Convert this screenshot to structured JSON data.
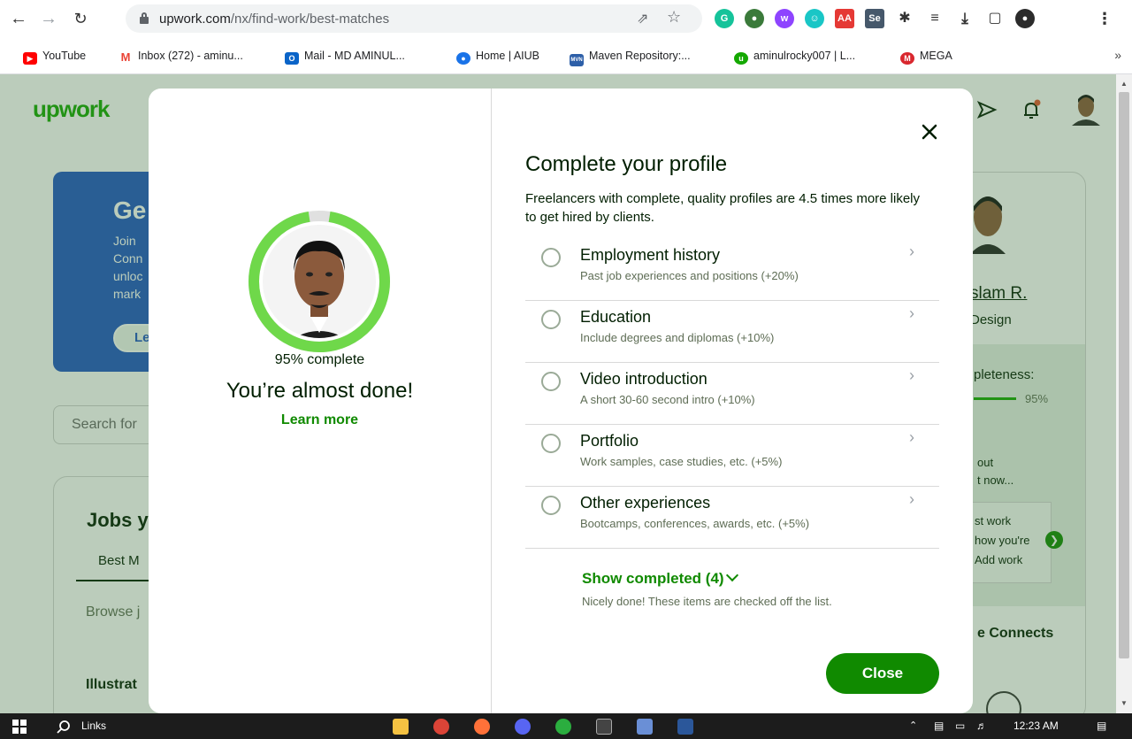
{
  "browser": {
    "url_host": "upwork.com",
    "url_path": "/nx/find-work/best-matches",
    "bookmarks": [
      {
        "label": "YouTube",
        "icon": "youtube-icon",
        "color": "#ff0000"
      },
      {
        "label": "Inbox (272) - aminu...",
        "icon": "gmail-icon",
        "color": "#ea4335"
      },
      {
        "label": "Mail - MD AMINUL...",
        "icon": "outlook-icon",
        "color": "#0a64c8"
      },
      {
        "label": "Home | AIUB",
        "icon": "aiub-icon",
        "color": "#1a73e8"
      },
      {
        "label": "Maven Repository:...",
        "icon": "maven-icon",
        "color": "#2d5fa8"
      },
      {
        "label": "aminulrocky007 | L...",
        "icon": "upwork-fav-icon",
        "color": "#14a800"
      },
      {
        "label": "MEGA",
        "icon": "mega-icon",
        "color": "#d9272e"
      }
    ],
    "bookmarks_more": "»"
  },
  "background": {
    "logo": "upwork",
    "promo_title": "Ge",
    "promo_lines": [
      "Join",
      "Conn",
      "unloc",
      "mark"
    ],
    "promo_button": "Le",
    "search_placeholder": "Search for",
    "jobs_heading": "Jobs y",
    "jobs_tab": "Best M",
    "jobs_browse": "Browse j",
    "jobs_item": "Illustrat",
    "profile_name": "slam R.",
    "profile_title": "Design",
    "completeness_label": "pleteness:",
    "completeness_pct": "95%",
    "out_lines": [
      "out",
      "t now..."
    ],
    "box_lines": [
      "st work",
      "how you're",
      "Add work"
    ],
    "connects": "e Connects"
  },
  "modal": {
    "percent_complete": 95,
    "percent_label": "95% complete",
    "heading": "You’re almost done!",
    "learn_more": "Learn more",
    "title": "Complete your profile",
    "subtitle": "Freelancers with complete, quality profiles are 4.5 times more likely to get hired by clients.",
    "items": [
      {
        "title": "Employment history",
        "desc": "Past job experiences and positions (+20%)"
      },
      {
        "title": "Education",
        "desc": "Include degrees and diplomas (+10%)"
      },
      {
        "title": "Video introduction",
        "desc": "A short 30-60 second intro (+10%)"
      },
      {
        "title": "Portfolio",
        "desc": "Work samples, case studies, etc. (+5%)"
      },
      {
        "title": "Other experiences",
        "desc": "Bootcamps, conferences, awards, etc. (+5%)"
      }
    ],
    "show_completed": "Show completed (4)",
    "nicely_done": "Nicely done! These items are checked off the list.",
    "close_button": "Close",
    "accent_color": "#108a00",
    "ring_color": "#6fd84a"
  },
  "taskbar": {
    "search_label": "Links",
    "time": "12:23 AM"
  }
}
